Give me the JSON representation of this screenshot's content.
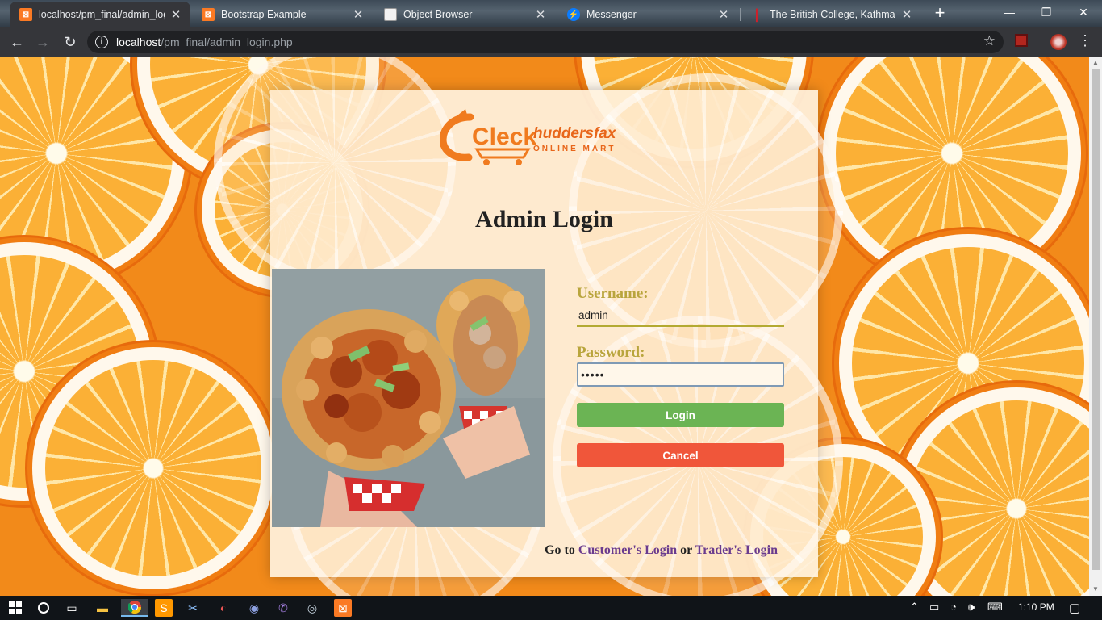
{
  "browser": {
    "tabs": [
      {
        "title": "localhost/pm_final/admin_log",
        "icon": "xampp-icon",
        "active": true
      },
      {
        "title": "Bootstrap Example",
        "icon": "xampp-icon",
        "active": false
      },
      {
        "title": "Object Browser",
        "icon": "document-icon",
        "active": false
      },
      {
        "title": "Messenger",
        "icon": "messenger-icon",
        "active": false
      },
      {
        "title": "The British College, Kathmandu",
        "icon": "college-icon",
        "active": false
      }
    ],
    "new_tab_label": "+",
    "url_host": "localhost",
    "url_path": "/pm_final/admin_login.php"
  },
  "page": {
    "logo_alt": "Cleckhuddersfax Online Mart",
    "logo_word1": "Cleck",
    "logo_word2": "huddersfax",
    "logo_sub": "ONLINE MART",
    "title": "Admin Login",
    "username_label": "Username:",
    "username_value": "admin",
    "password_label": "Password:",
    "password_value": "•••••",
    "login_label": "Login",
    "cancel_label": "Cancel",
    "goto_prefix": "Go to",
    "customer_link": "Customer's Login",
    "goto_or": "or",
    "trader_link": "Trader's Login"
  },
  "colors": {
    "login_button": "#6bb454",
    "cancel_button": "#f0563a",
    "label_color": "#b9a53d",
    "link_color": "#6a3b8e"
  },
  "taskbar": {
    "time": "1:10 PM",
    "apps": [
      "windows-icon",
      "cortana-icon",
      "task-view-icon",
      "file-explorer-icon",
      "chrome-icon",
      "sublime-icon",
      "snipping-icon",
      "vpn-icon",
      "discord-icon",
      "viber-icon",
      "steam-icon",
      "xampp-icon"
    ]
  }
}
